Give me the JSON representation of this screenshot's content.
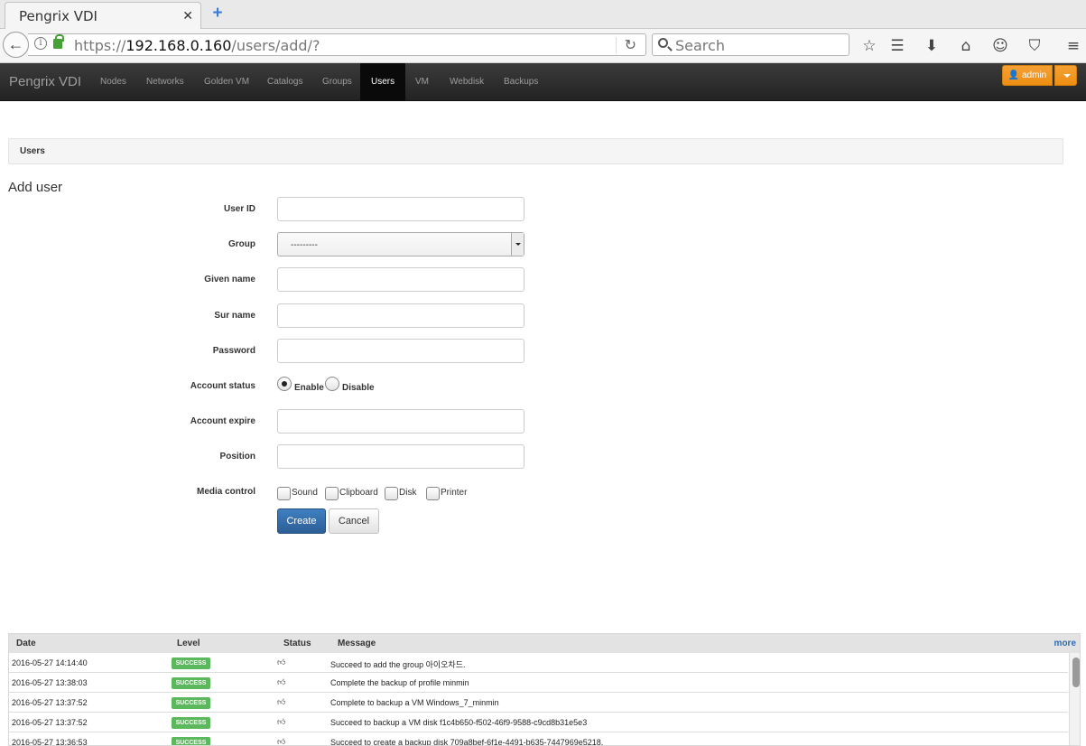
{
  "browser": {
    "tab_title": "Pengrix VDI",
    "tab_close": "✕",
    "new_tab": "+",
    "url_prefix": "https://",
    "url_host": "192.168.0.160",
    "url_path": "/users/add/?",
    "search_placeholder": "Search",
    "icons": [
      "back-icon",
      "info-icon",
      "lock-icon",
      "reload-icon",
      "search-icon",
      "bookmark-star-icon",
      "reading-list-icon",
      "download-icon",
      "home-icon",
      "smiley-icon",
      "pocket-icon",
      "menu-icon"
    ]
  },
  "app": {
    "brand": "Pengrix VDI",
    "nav": [
      "Nodes",
      "Networks",
      "Golden VM",
      "Catalogs",
      "Groups",
      "Users",
      "VM",
      "Webdisk",
      "Backups"
    ],
    "active_nav": "Users",
    "user_button": "admin",
    "accent_color": "#f0961e"
  },
  "breadcrumb": "Users",
  "page_title": "Add user",
  "form": {
    "user_id_label": "User ID",
    "group_label": "Group",
    "group_value": "---------",
    "given_name_label": "Given name",
    "sur_name_label": "Sur name",
    "password_label": "Password",
    "account_status_label": "Account status",
    "status_enable": "Enable",
    "status_disable": "Disable",
    "status_selected": "Enable",
    "account_expire_label": "Account expire",
    "position_label": "Position",
    "media_control_label": "Media control",
    "media_sound": "Sound",
    "media_clipboard": "Clipboard",
    "media_disk": "Disk",
    "media_printer": "Printer",
    "create_label": "Create",
    "cancel_label": "Cancel"
  },
  "log": {
    "headers": {
      "date": "Date",
      "level": "Level",
      "status": "Status",
      "message": "Message",
      "more": "more"
    },
    "rows": [
      {
        "date": "2016-05-27 14:14:40",
        "level": "SUCCESS",
        "message": "Succeed to add the group 아이오차드."
      },
      {
        "date": "2016-05-27 13:38:03",
        "level": "SUCCESS",
        "message": "Complete the backup of profile minmin"
      },
      {
        "date": "2016-05-27 13:37:52",
        "level": "SUCCESS",
        "message": "Complete to backup a VM Windows_7_minmin"
      },
      {
        "date": "2016-05-27 13:37:52",
        "level": "SUCCESS",
        "message": "Succeed to backup a VM disk f1c4b650-f502-46f9-9588-c9cd8b31e5e3"
      },
      {
        "date": "2016-05-27 13:36:53",
        "level": "SUCCESS",
        "message": "Succeed to create a backup disk 709a8bef-6f1e-4491-b635-7447969e5218."
      }
    ],
    "success_color": "#5cb85c"
  }
}
